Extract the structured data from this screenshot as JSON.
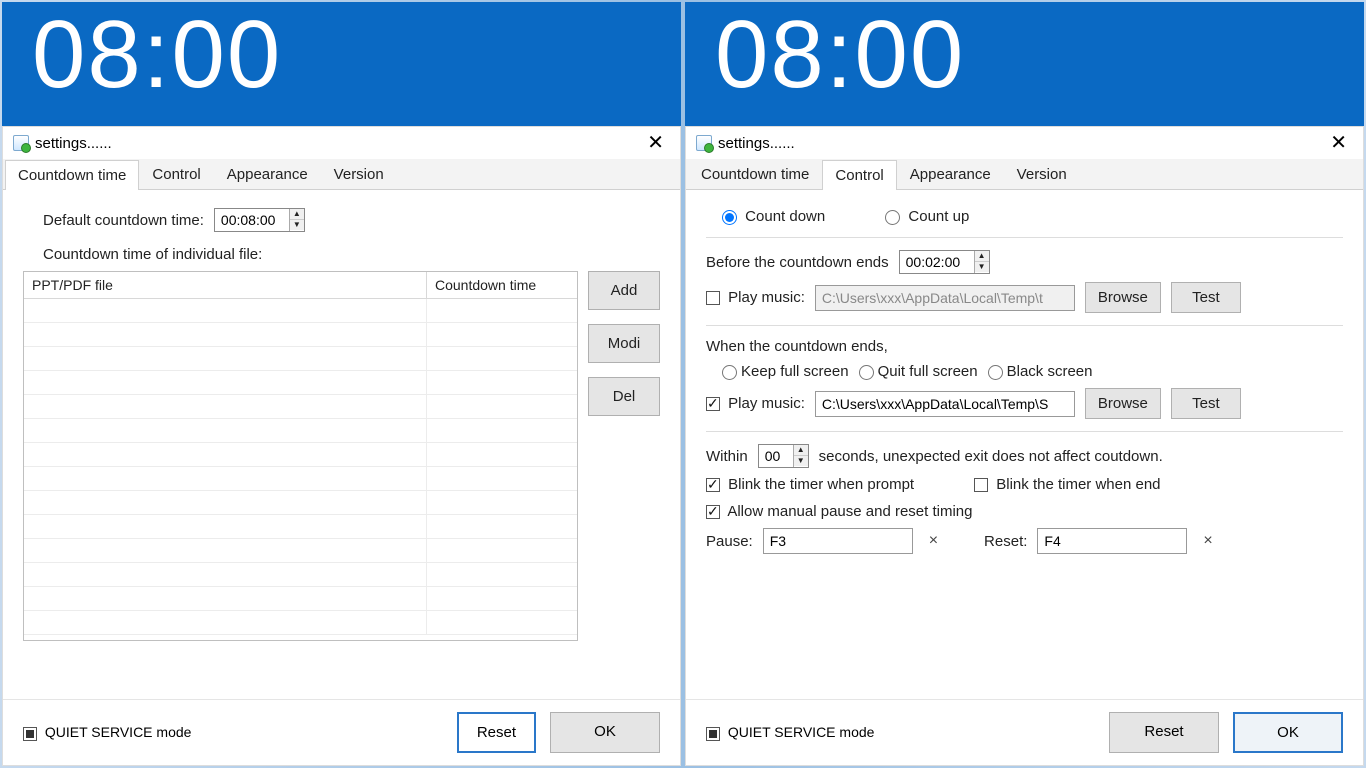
{
  "clock": "08:00",
  "window_title": "settings......",
  "tabs": {
    "countdown": "Countdown time",
    "control": "Control",
    "appearance": "Appearance",
    "version": "Version"
  },
  "countdown_tab": {
    "default_label": "Default countdown time:",
    "default_value": "00:08:00",
    "list_label": "Countdown time of individual file:",
    "col_file": "PPT/PDF file",
    "col_time": "Countdown time",
    "add": "Add",
    "modi": "Modi",
    "del": "Del"
  },
  "control_tab": {
    "count_down": "Count down",
    "count_up": "Count up",
    "before_label": "Before the countdown ends",
    "before_value": "00:02:00",
    "play_music1": "Play music:",
    "music1_path": "C:\\Users\\xxx\\AppData\\Local\\Temp\\t",
    "browse": "Browse",
    "test": "Test",
    "when_label": "When the countdown ends,",
    "keep_fs": "Keep  full screen",
    "quit_fs": "Quit  full screen",
    "black": "Black screen",
    "play_music2": "Play music:",
    "music2_path": "C:\\Users\\xxx\\AppData\\Local\\Temp\\S",
    "within1": "Within",
    "within_val": "00",
    "within2": "seconds, unexpected exit does not affect coutdown.",
    "blink_prompt": "Blink the timer when prompt",
    "blink_end": "Blink the timer when end",
    "allow_pause": "Allow manual pause and reset timing",
    "pause_lbl": "Pause:",
    "pause_val": "F3",
    "reset_lbl": "Reset:",
    "reset_val": "F4"
  },
  "footer": {
    "quiet": "QUIET SERVICE mode",
    "reset": "Reset",
    "ok": "OK"
  }
}
